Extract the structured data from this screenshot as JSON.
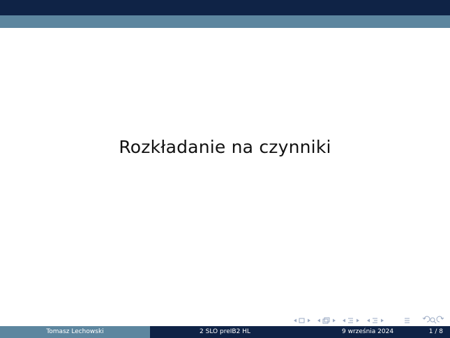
{
  "slide": {
    "title": "Rozkładanie na czynniki"
  },
  "footer": {
    "author": "Tomasz Lechowski",
    "title": "2 SLO preIB2 HL",
    "date": "9 września 2024",
    "page": "1 / 8"
  },
  "navigation": {
    "controls": [
      "prev-slide",
      "slide-icon",
      "next-slide",
      "prev-frame",
      "frame-icon",
      "next-frame",
      "prev-subsection",
      "subsection-icon",
      "next-subsection",
      "prev-section",
      "section-icon",
      "next-section",
      "toc",
      "back",
      "search",
      "forward"
    ]
  },
  "colors": {
    "header_dark": "#0f2346",
    "header_band": "#5d869f",
    "nav_icon": "#9aa9c3"
  }
}
